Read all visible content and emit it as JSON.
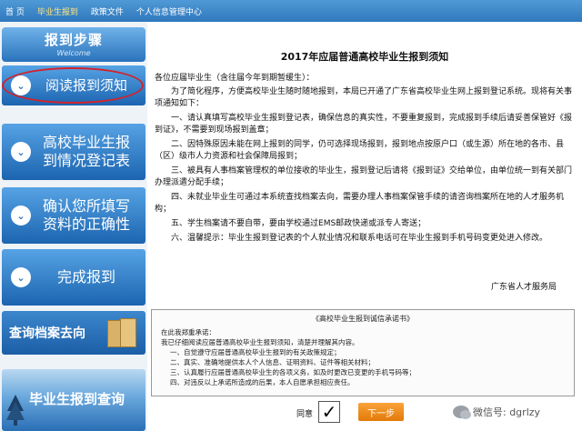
{
  "nav": {
    "items": [
      {
        "label": "首 页"
      },
      {
        "label": "毕业生报到"
      },
      {
        "label": "政策文件"
      },
      {
        "label": "个人信息管理中心"
      }
    ]
  },
  "sidebar": {
    "header_title": "报到步骤",
    "header_subtitle": "Welcome",
    "steps": [
      {
        "label": "阅读报到须知"
      },
      {
        "label_line1": "高校毕业生报",
        "label_line2": "到情况登记表"
      },
      {
        "label_line1": "确认您所填写",
        "label_line2": "资料的正确性"
      },
      {
        "label": "完成报到"
      }
    ],
    "query_archive": "查询档案去向",
    "query_report": "毕业生报到查询"
  },
  "notice": {
    "title": "2017年应届普通高校毕业生报到须知",
    "salutation": "各位应届毕业生（含往届今年到期暂缓生）：",
    "paragraphs": [
      "为了简化程序，方便高校毕业生随时随地报到，本局已开通了广东省高校毕业生网上报到登记系统。现将有关事项通知如下：",
      "一、请认真填写高校毕业生报到登记表，确保信息的真实性，不要重复报到，完成报到手续后请妥善保管好《报到证》，不需要到现场报到盖章；",
      "二、因特殊原因未能在网上报到的同学，仍可选择现场报到，报到地点按原户口（或生源）所在地的各市、县（区）级市人力资源和社会保障局报到；",
      "三、被具有人事档案管理权的单位接收的毕业生，报到登记后请将《报到证》交给单位，由单位统一到有关部门办理派遣分配手续；",
      "四、未就业毕业生可通过本系统查找档案去向，需要办理人事档案保管手续的请咨询档案所在地的人才服务机构；",
      "五、学生档案请不要自带，要由学校通过EMS邮政快递或派专人寄送；",
      "六、温馨提示：毕业生报到登记表的个人就业情况和联系电话可在毕业生报到手机号码变更处进入修改。"
    ],
    "signature": "广东省人才服务局"
  },
  "pledge": {
    "title": "《高校毕业生报到诚信承诺书》",
    "intro1": "在此我郑重承诺：",
    "intro2": "我已仔细阅读应届普通高校毕业生报到须知，清楚并理解其内容。",
    "items": [
      "一、自觉遵守应届普通高校毕业生报到的有关政策规定；",
      "二、真实、准确地提供本人个人信息、证明资料、证件等相关材料；",
      "三、认真履行应届普通高校毕业生的各项义务，如及时更改已变更的手机号码等；",
      "四、对违反以上承诺所造成的后果，本人自愿承担相应责任。"
    ]
  },
  "actions": {
    "agree_label": "同意",
    "checkbox_mark": "✓",
    "next_label": "下一步"
  },
  "watermark": "微信号: dgrlzy",
  "colors": {
    "nav_blue": "#2f78bd",
    "step_blue": "#1c64b0",
    "highlight_red": "#d4222a",
    "next_orange": "#e27a08"
  }
}
